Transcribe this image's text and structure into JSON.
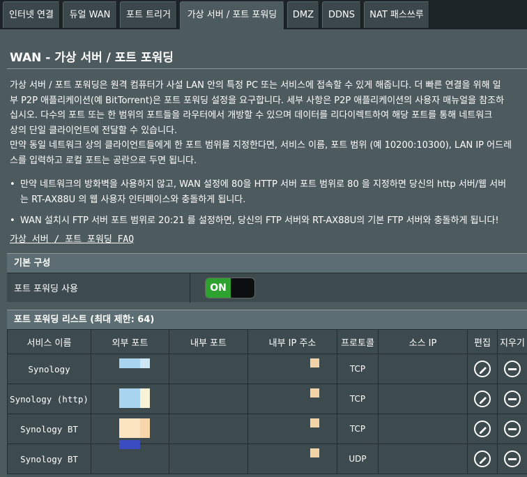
{
  "tabs": [
    {
      "label": "인터넷 연결",
      "active": false
    },
    {
      "label": "듀얼 WAN",
      "active": false
    },
    {
      "label": "포트 트리거",
      "active": false
    },
    {
      "label": "가상 서버 / 포트 포워딩",
      "active": true
    },
    {
      "label": "DMZ",
      "active": false
    },
    {
      "label": "DDNS",
      "active": false
    },
    {
      "label": "NAT 패스쓰루",
      "active": false
    }
  ],
  "page": {
    "title": "WAN - 가상 서버 / 포트 포워딩",
    "desc_lines": [
      "가상 서버 / 포트 포워딩은 원격 컴퓨터가 사설 LAN 안의 특정 PC 또는 서비스에 접속할 수 있게 해줍니다. 더 빠른 연결을 위해 일",
      "부 P2P 애플리케이션(예 BitTorrent)은 포트 포워딩 설정을 요구합니다. 세부 사항은 P2P 애플리케이션의 사용자 매뉴얼을 참조하",
      "십시오. 다수의 포트 또는 한 범위의 포트들을 라우터에서 개방할 수 있으며 데이터를 리다이렉트하여 해당 포트를 통해 네트워크",
      "상의 단일 클라이언트에 전달할 수 있습니다.",
      "만약 동일 네트워크 상의 클라이언트들에게 한 포트 범위를 지정한다면, 서비스 이름, 포트 범위 (예 10200:10300), LAN IP 어드레",
      "스를 입력하고 로컬 포트는 공란으로 두면 됩니다."
    ],
    "bullets": [
      [
        "만약 네트워크의 방화벽을 사용하지 않고, WAN 설정에 80을 HTTP 서버 포트 범위로 80 을 지정하면 당신의 http 서버/웹 서버",
        "는 RT-AX88U 의 웹 사용자 인터페이스와 충돌하게 됩니다."
      ],
      [
        "WAN 설치시 FTP 서버 포트 범위로 20:21 를 설정하면, 당신의 FTP 서버와 RT-AX88U의 기본 FTP 서버와 충돌하게 됩니다!"
      ]
    ],
    "faq_link": "가상 서버 / 포트 포워딩 FAQ"
  },
  "basic": {
    "header": "기본 구성",
    "enable_label": "포트 포워딩 사용",
    "toggle_label": "ON"
  },
  "list": {
    "header": "포트 포워딩 리스트 (최대 제한: 64)",
    "columns": [
      "서비스 이름",
      "외부 포트",
      "내부 포트",
      "내부 IP 주소",
      "프로토콜",
      "소스 IP",
      "편집",
      "지우기"
    ],
    "rows": [
      {
        "service": "Synology",
        "protocol": "TCP"
      },
      {
        "service": "Synology (http)",
        "protocol": "TCP"
      },
      {
        "service": "Synology BT",
        "protocol": "TCP"
      },
      {
        "service": "Synology BT",
        "protocol": "UDP"
      }
    ]
  },
  "icons": {
    "edit": "pencil-icon",
    "delete": "minus-circle-icon"
  },
  "colors": {
    "toggle_on": "#2ea22e",
    "page_bg": "#4d5a5e"
  }
}
